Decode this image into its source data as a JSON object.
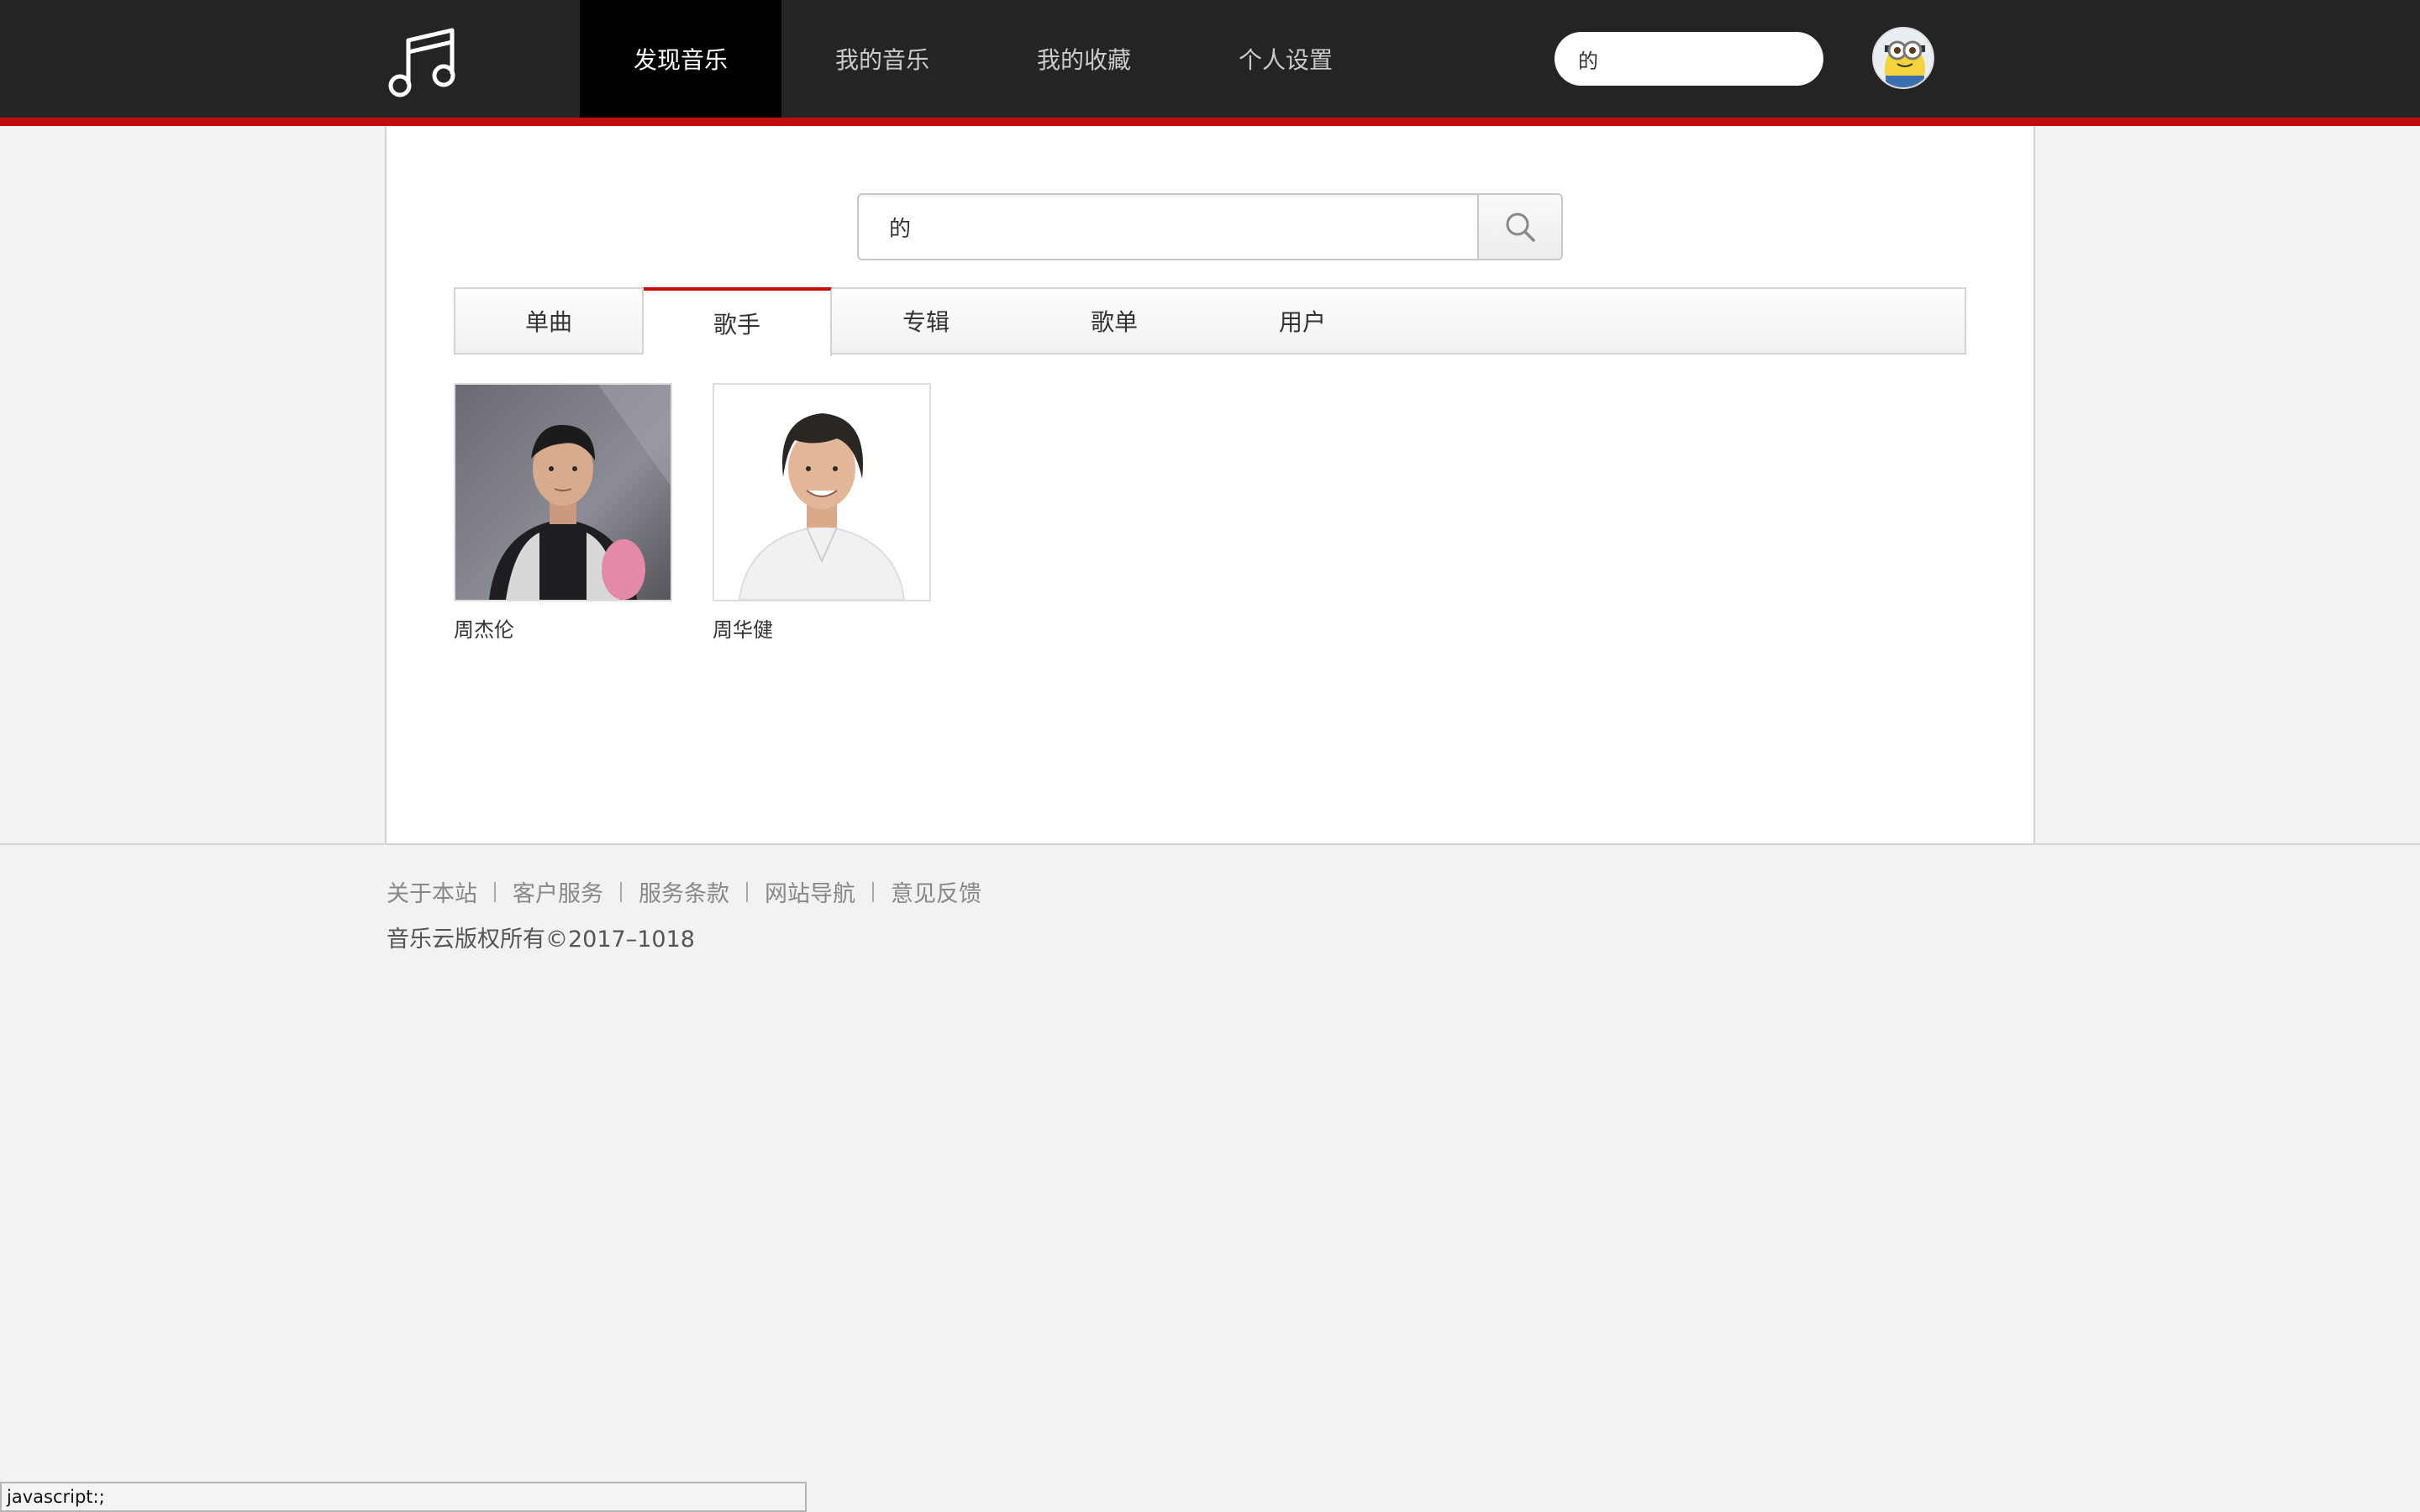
{
  "nav": {
    "logo_icon": "music-note-icon",
    "items": [
      {
        "label": "发现音乐",
        "active": true
      },
      {
        "label": "我的音乐",
        "active": false
      },
      {
        "label": "我的收藏",
        "active": false
      },
      {
        "label": "个人设置",
        "active": false
      }
    ],
    "search_value": "的",
    "avatar_icon": "minion-avatar-icon"
  },
  "search": {
    "value": "的",
    "button_icon": "search-icon"
  },
  "tabs": [
    {
      "label": "单曲",
      "active": false
    },
    {
      "label": "歌手",
      "active": true
    },
    {
      "label": "专辑",
      "active": false
    },
    {
      "label": "歌单",
      "active": false
    },
    {
      "label": "用户",
      "active": false
    }
  ],
  "artists": [
    {
      "name": "周杰伦"
    },
    {
      "name": "周华健"
    }
  ],
  "footer": {
    "links": [
      "关于本站",
      "客户服务",
      "服务条款",
      "网站导航",
      "意见反馈"
    ],
    "copyright": "音乐云版权所有©2017–1018"
  },
  "statusbar": {
    "text": "javascript:;"
  },
  "colors": {
    "topbar": "#242424",
    "accent_red": "#c20c0c",
    "page_bg": "#f2f2f2"
  }
}
